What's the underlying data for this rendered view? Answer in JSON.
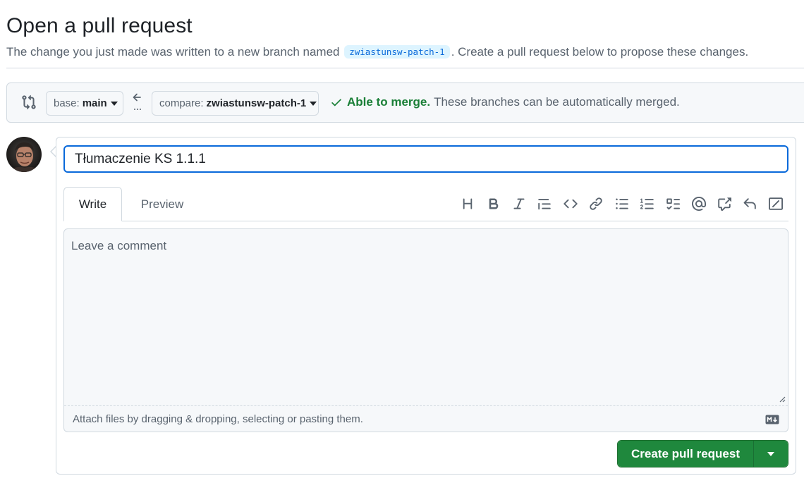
{
  "page": {
    "title": "Open a pull request",
    "subtitle_before": "The change you just made was written to a new branch named",
    "branch_name": "zwiastunsw-patch-1",
    "subtitle_after": ". Create a pull request below to propose these changes."
  },
  "range": {
    "base_prefix": "base:",
    "base_branch": "main",
    "compare_prefix": "compare:",
    "compare_branch": "zwiastunsw-patch-1",
    "merge_ok": "Able to merge.",
    "merge_detail": "These branches can be automatically merged."
  },
  "composer": {
    "title_value": "Tłumaczenie KS 1.1.1",
    "tabs": [
      {
        "label": "Write",
        "active": true
      },
      {
        "label": "Preview",
        "active": false
      }
    ],
    "toolbar_icons": [
      "heading-icon",
      "bold-icon",
      "italic-icon",
      "quote-icon",
      "code-icon",
      "link-icon",
      "unordered-list-icon",
      "ordered-list-icon",
      "task-list-icon",
      "mention-icon",
      "cross-reference-icon",
      "saved-reply-icon",
      "slash-command-icon"
    ],
    "comment_placeholder": "Leave a comment",
    "attach_text": "Attach files by dragging & dropping, selecting or pasting them.",
    "submit_label": "Create pull request"
  },
  "colors": {
    "accent": "#0969da",
    "success": "#1a7f37",
    "button_green": "#1f883d",
    "border": "#d1d9e0",
    "muted_text": "#59636e",
    "branch_bg": "#ddf4ff"
  }
}
